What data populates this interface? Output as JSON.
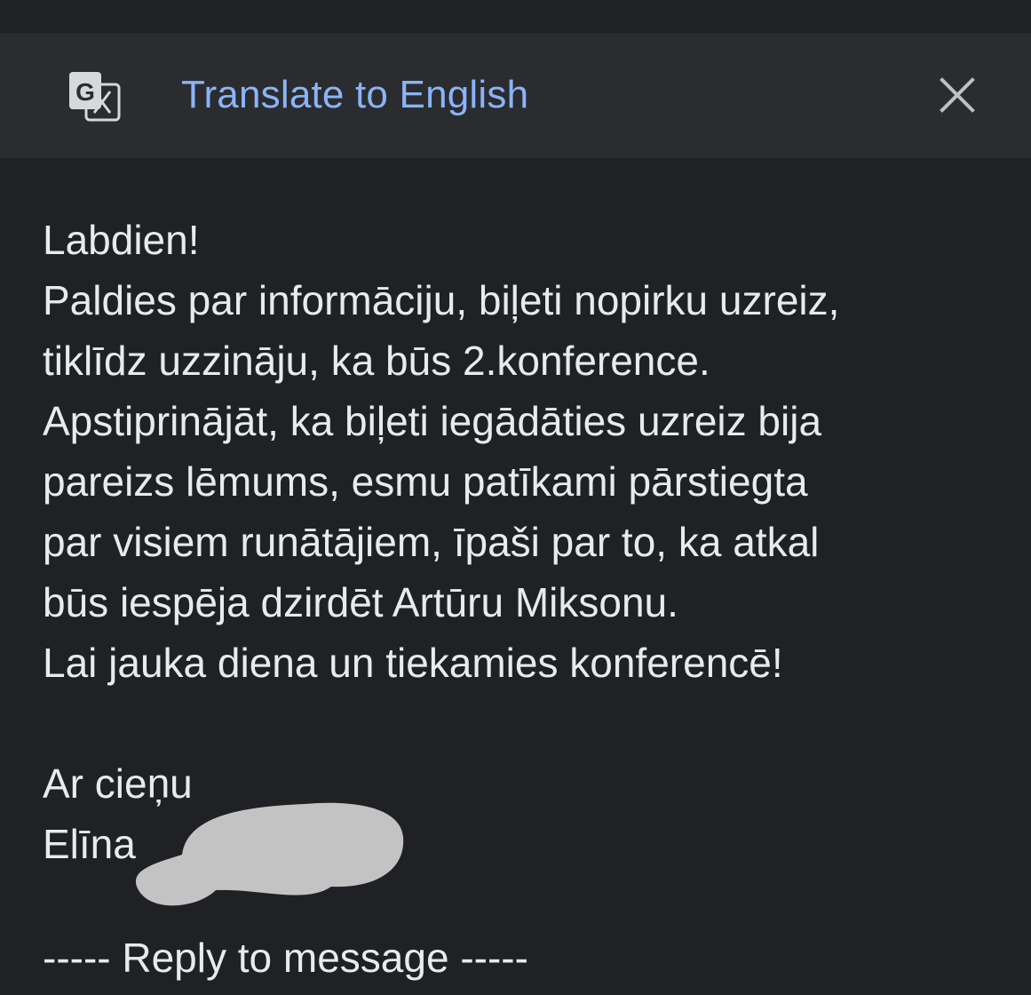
{
  "translate_bar": {
    "label": "Translate to English",
    "translate_icon": "google-translate-icon",
    "close_icon": "close-icon",
    "accent_color": "#8ab4f8"
  },
  "message": {
    "lines": [
      "Labdien!",
      "Paldies par informāciju, biļeti nopirku uzreiz,",
      "tiklīdz uzzināju, ka būs 2.konference.",
      "Apstiprinājāt, ka biļeti iegādāties uzreiz bija",
      "pareizs lēmums, esmu patīkami pārstiegta",
      "par visiem runātājiem, īpaši par to, ka atkal",
      "būs iespēja dzirdēt Artūru Miksonu.",
      "Lai jauka diena un tiekamies konferencē!"
    ],
    "closing": "Ar cieņu",
    "signature": "Elīna"
  },
  "reply_divider": "----- Reply to message -----",
  "colors": {
    "background": "#202124",
    "bar_background": "#2b2c2f",
    "text": "#e8eaed",
    "redaction": "#c3c3c3"
  }
}
